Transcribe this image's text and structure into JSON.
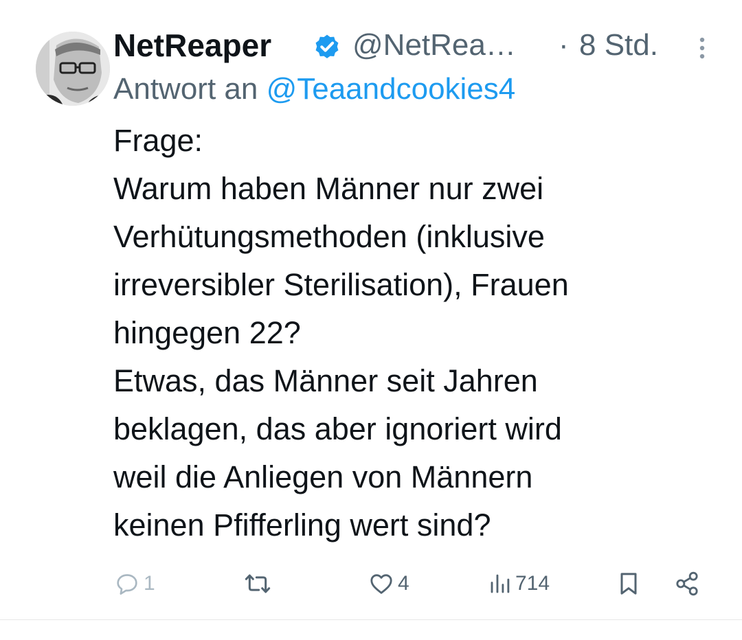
{
  "user": {
    "name": "NetReaper",
    "handle": "@NetRea…",
    "separator": "·",
    "time": "8 Std."
  },
  "reply": {
    "prefix": "Antwort an",
    "mention": "@Teaandcookies4"
  },
  "tweet": {
    "lines": [
      "Frage:",
      "Warum haben Männer nur zwei",
      "Verhütungsmethoden (inklusive",
      "irreversibler Sterilisation), Frauen",
      "hingegen 22?",
      "Etwas, das Männer seit Jahren",
      "beklagen, das aber ignoriert wird",
      "weil die Anliegen von Männern",
      "keinen Pfifferling wert sind?"
    ]
  },
  "actions": {
    "replies": "1",
    "likes": "4",
    "views": "714"
  },
  "colors": {
    "text": "#0f1419",
    "secondary": "#536471",
    "accent": "#1d9bf0"
  }
}
